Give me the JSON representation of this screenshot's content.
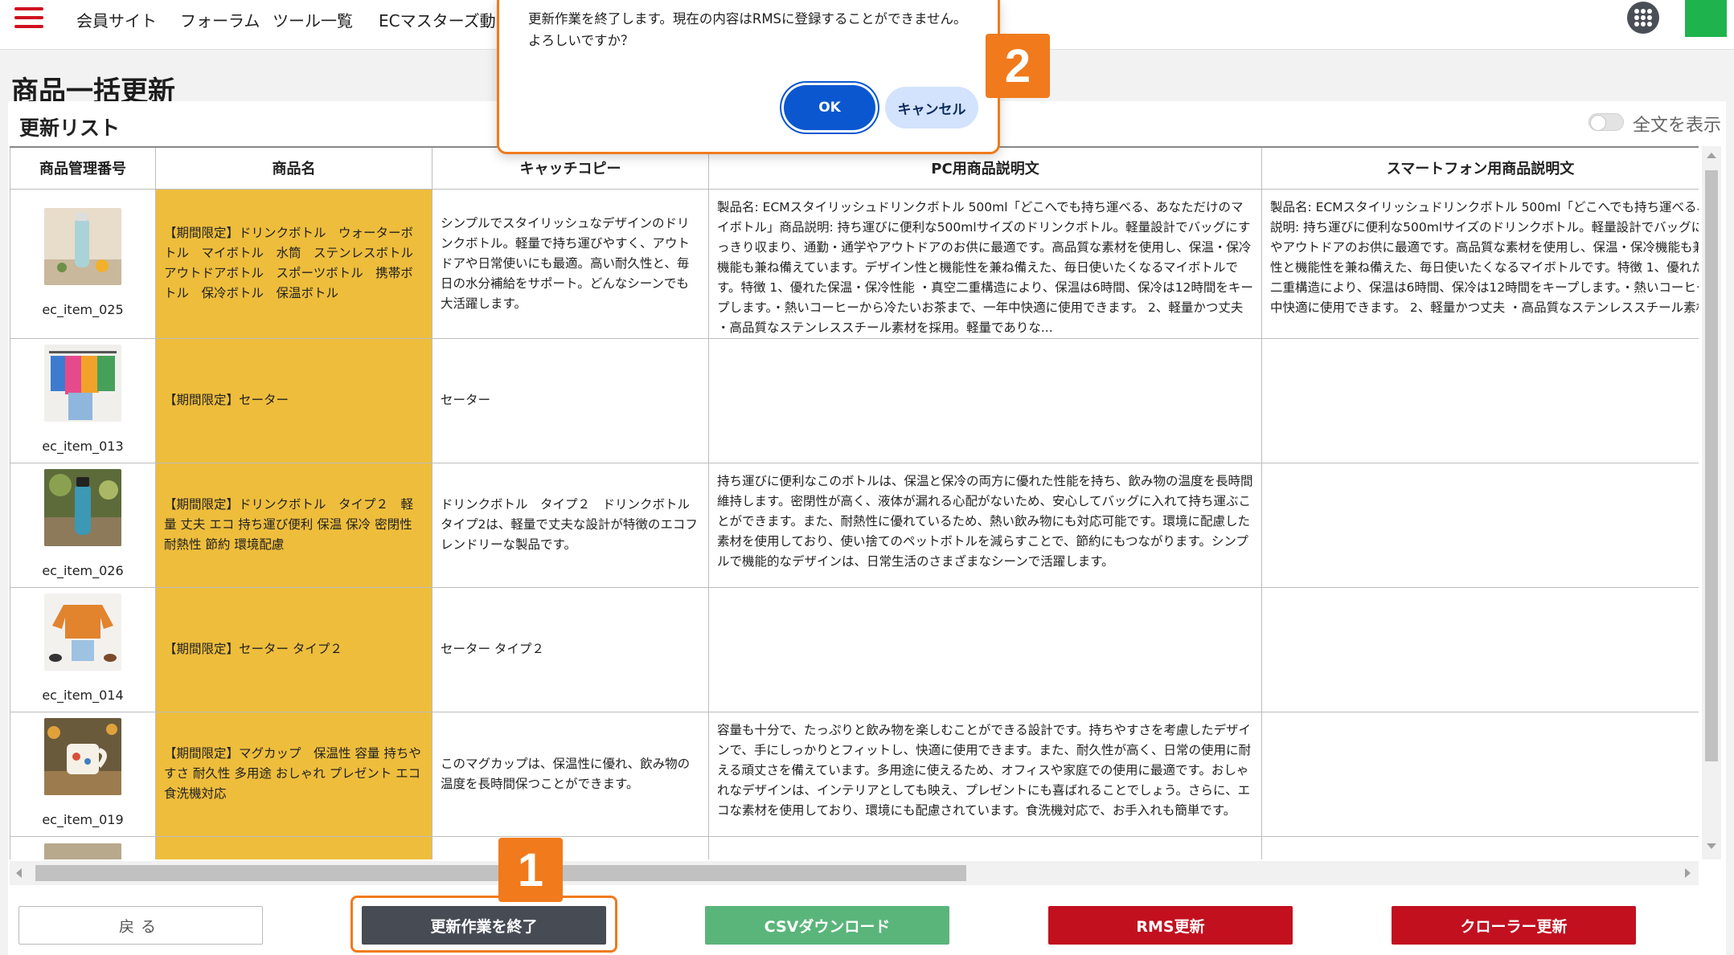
{
  "nav": {
    "links": [
      "会員サイト",
      "フォーラム",
      "ツール一覧",
      "ECマスターズ動画"
    ]
  },
  "page": {
    "title": "商品一括更新",
    "list_title": "更新リスト",
    "toggle_label": "全文を表示",
    "toggle_on": false
  },
  "table": {
    "headers": [
      "商品管理番号",
      "商品名",
      "キャッチコピー",
      "PC用商品説明文",
      "スマートフォン用商品説明文"
    ],
    "rows": [
      {
        "id": "ec_item_025",
        "name": "【期間限定】ドリンクボトル　ウォーターボトル　マイボトル　水筒　ステンレスボトル　アウトドアボトル　スポーツボトル　携帯ボトル　保冷ボトル　保温ボトル",
        "catch": "シンプルでスタイリッシュなデザインのドリンクボトル。軽量で持ち運びやすく、アウトドアや日常使いにも最適。高い耐久性と、毎日の水分補給をサポート。どんなシーンでも大活躍します。",
        "pc": "製品名: ECMスタイリッシュドリンクボトル 500ml「どこへでも持ち運べる、あなただけのマイボトル」商品説明: 持ち運びに便利な500mlサイズのドリンクボトル。軽量設計でバッグにすっきり収まり、通勤・通学やアウトドアのお供に最適です。高品質な素材を使用し、保温・保冷機能も兼ね備えています。デザイン性と機能性を兼ね備えた、毎日使いたくなるマイボトルです。特徴 1、優れた保温・保冷性能 ・真空二重構造により、保温は6時間、保冷は12時間をキープします。・熱いコーヒーから冷たいお茶まで、一年中快適に使用できます。 2、軽量かつ丈夫 ・高品質なステンレススチール素材を採用。軽量でありな...",
        "sp_lines": [
          "製品名: ECMスタイリッシュドリンクボトル 500ml「どこへでも持ち運べる、あなただけ",
          "説明: 持ち運びに便利な500mlサイズのドリンクボトル。軽量設計でバッグにすっきり",
          "やアウトドアのお供に最適です。高品質な素材を使用し、保温・保冷機能も兼ね備",
          "性と機能性を兼ね備えた、毎日使いたくなるマイボトルです。特徴 1、優れた保温",
          "二重構造により、保温は6時間、保冷は12時間をキープします。・熱いコーヒーから冷",
          "中快適に使用できます。 2、軽量かつ丈夫 ・高品質なステンレススチール素材を採"
        ],
        "thumb": "bottle-white"
      },
      {
        "id": "ec_item_013",
        "name": "【期間限定】セーター",
        "catch": "セーター",
        "pc": "",
        "sp_lines": [],
        "thumb": "sweaters-rack"
      },
      {
        "id": "ec_item_026",
        "name": "【期間限定】ドリンクボトル　タイプ２　軽量 丈夫 エコ 持ち運び便利 保温 保冷 密閉性 耐熱性 節約 環境配慮",
        "catch": "ドリンクボトル　タイプ２　ドリンクボトル タイプ2は、軽量で丈夫な設計が特徴のエコフレンドリーな製品です。",
        "pc": "持ち運びに便利なこのボトルは、保温と保冷の両方に優れた性能を持ち、飲み物の温度を長時間維持します。密閉性が高く、液体が漏れる心配がないため、安心してバッグに入れて持ち運ぶことができます。また、耐熱性に優れているため、熱い飲み物にも対応可能です。環境に配慮した素材を使用しており、使い捨てのペットボトルを減らすことで、節約にもつながります。シンプルで機能的なデザインは、日常生活のさまざまなシーンで活躍します。",
        "sp_lines": [],
        "thumb": "bottle-blue"
      },
      {
        "id": "ec_item_014",
        "name": "【期間限定】セーター タイプ２",
        "catch": "セーター タイプ２",
        "pc": "",
        "sp_lines": [],
        "thumb": "sweater-orange"
      },
      {
        "id": "ec_item_019",
        "name": "【期間限定】マグカップ　保温性 容量 持ちやすさ 耐久性 多用途 おしゃれ プレゼント エコ 食洗機対応",
        "catch": "このマグカップは、保温性に優れ、飲み物の温度を長時間保つことができます。",
        "pc": "容量も十分で、たっぷりと飲み物を楽しむことができる設計です。持ちやすさを考慮したデザインで、手にしっかりとフィットし、快適に使用できます。また、耐久性が高く、日常の使用に耐える頑丈さを備えています。多用途に使えるため、オフィスや家庭での使用に最適です。おしゃれなデザインは、インテリアとしても映え、プレゼントにも喜ばれることでしょう。さらに、エコな素材を使用しており、環境にも配慮されています。食洗機対応で、お手入れも簡単です。",
        "sp_lines": [],
        "thumb": "mug"
      },
      {
        "id": "",
        "name": "",
        "catch": "",
        "pc": "",
        "sp_lines": [],
        "thumb": "partial"
      }
    ]
  },
  "footer": {
    "back": "戻る",
    "finish": "更新作業を終了",
    "csv": "CSVダウンロード",
    "rms": "RMS更新",
    "crawler": "クローラー更新"
  },
  "dialog": {
    "line1": "更新作業を終了します。現在の内容はRMSに登録することができません。",
    "line2": "よろしいですか？",
    "ok": "OK",
    "cancel": "キャンセル"
  },
  "annotations": {
    "badge1": "1",
    "badge2": "2",
    "color": "#f07a1c"
  },
  "colors": {
    "accent_red": "#c2101f",
    "name_col_yellow": "#eebd3c",
    "csv_green": "#5ab57a",
    "finish_dark": "#474b54",
    "dialog_blue": "#0b57d0"
  }
}
